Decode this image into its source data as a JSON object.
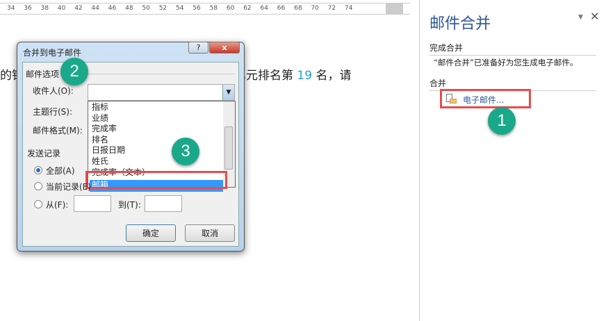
{
  "ruler": {
    "ticks": [
      "34",
      "36",
      "38",
      "40",
      "42",
      "44",
      "46",
      "48",
      "50",
      "52",
      "54",
      "56",
      "58",
      "60",
      "62",
      "64",
      "66",
      "68",
      "70",
      "72",
      "74"
    ]
  },
  "document": {
    "text_left": "的销",
    "text_right_a": "务单元排名第 ",
    "rank": "19",
    "text_right_b": " 名，请"
  },
  "dialog": {
    "title": "合并到电子邮件",
    "help": "?",
    "close": "x",
    "group_mail": "邮件选项",
    "to_label": "收件人(O):",
    "subject_label": "主题行(S):",
    "format_label": "邮件格式(M):",
    "dropdown_options": [
      "指标",
      "业绩",
      "完成率",
      "排名",
      "日报日期",
      "姓氏",
      "完成率（文本）",
      "邮箱"
    ],
    "selected": "邮箱",
    "group_send": "发送记录",
    "radio_all": "全部(A)",
    "radio_current": "当前记录(E)",
    "radio_from": "从(F):",
    "to": "到(T):",
    "ok": "确定",
    "cancel": "取消"
  },
  "pane": {
    "title": "邮件合并",
    "section1": "完成合并",
    "message": "“邮件合并”已准备好为您生成电子邮件。",
    "section2": "合并",
    "email_link": "电子邮件..."
  },
  "steps": [
    "1",
    "2",
    "3"
  ],
  "colors": {
    "accent": "#2b579a",
    "step": "#1aa88a",
    "highlight": "#e84c4c",
    "selection": "#3399ff"
  }
}
